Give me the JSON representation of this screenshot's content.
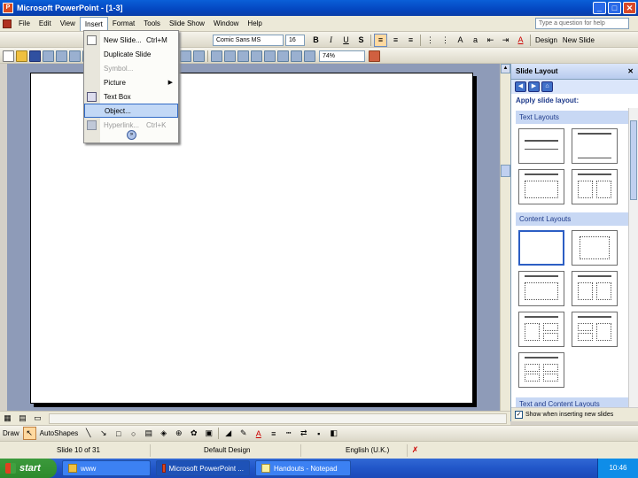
{
  "window": {
    "title": "Microsoft PowerPoint - [1-3]",
    "minimize": "_",
    "maximize": "□",
    "close": "✕"
  },
  "menu": {
    "items": [
      "File",
      "Edit",
      "View",
      "Insert",
      "Format",
      "Tools",
      "Slide Show",
      "Window",
      "Help"
    ],
    "help_placeholder": "Type a question for help"
  },
  "formatting": {
    "font": "Comic Sans MS",
    "size": "16",
    "bold": "B",
    "italic": "I",
    "underline": "U",
    "shadow": "S",
    "design": "Design",
    "new_slide": "New Slide"
  },
  "standard": {
    "zoom": "74%"
  },
  "insert_menu": {
    "items": [
      {
        "label": "New Slide...",
        "shortcut": "Ctrl+M"
      },
      {
        "label": "Duplicate Slide"
      },
      {
        "label": "Symbol..."
      },
      {
        "label": "Picture"
      },
      {
        "label": "Text Box"
      },
      {
        "label": "Object..."
      },
      {
        "label": "Hyperlink...",
        "shortcut": "Ctrl+K"
      }
    ]
  },
  "task_pane": {
    "title": "Slide Layout",
    "close": "✕",
    "subtitle": "Apply slide layout:",
    "text_layouts": "Text Layouts",
    "content_layouts": "Content Layouts",
    "text_content_layouts": "Text and Content Layouts",
    "show_when_inserting": "Show when inserting new slides"
  },
  "draw_toolbar": {
    "draw": "Draw",
    "autoshapes": "AutoShapes"
  },
  "status": {
    "slide": "Slide 10 of 31",
    "design": "Default Design",
    "language": "English (U.K.)"
  },
  "taskbar": {
    "start": "start",
    "tasks": [
      "www",
      "Microsoft PowerPoint ...",
      "Handouts - Notepad"
    ],
    "clock": "10:46"
  }
}
